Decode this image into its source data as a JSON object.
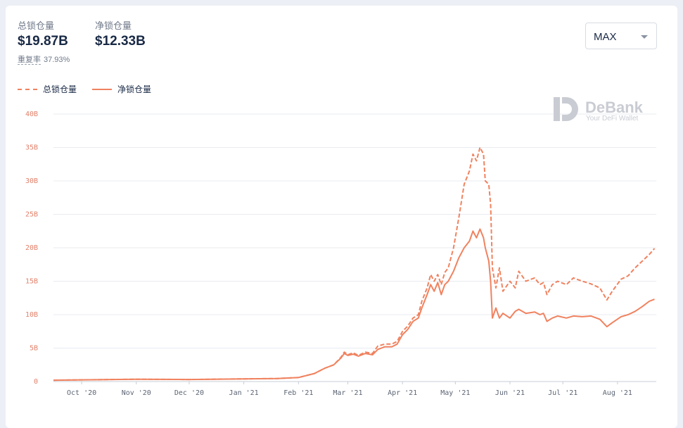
{
  "stats": {
    "total_label": "总锁仓量",
    "total_value": "$19.87B",
    "net_label": "净锁仓量",
    "net_value": "$12.33B",
    "overlap_label": "重复率",
    "overlap_value": "37.93%"
  },
  "range_select": {
    "value": "MAX"
  },
  "watermark": {
    "brand": "DeBank",
    "tagline": "Your DeFi Wallet"
  },
  "colors": {
    "line": "#f0825f",
    "tick": "#e2806a",
    "grid": "#e8ebf1",
    "axis": "#c7ccd6",
    "xtick": "#5b6474"
  },
  "chart_data": {
    "type": "line",
    "x_unit": "days",
    "x_range": [
      "2020-09-15",
      "2021-08-23"
    ],
    "ylim": [
      0,
      40
    ],
    "yticks": [
      0,
      5,
      10,
      15,
      20,
      25,
      30,
      35,
      40
    ],
    "ytick_labels": [
      "0",
      "5B",
      "10B",
      "15B",
      "20B",
      "25B",
      "30B",
      "35B",
      "40B"
    ],
    "xticks": [
      {
        "date": "2020-10-01",
        "label": "Oct '20"
      },
      {
        "date": "2020-11-01",
        "label": "Nov '20"
      },
      {
        "date": "2020-12-01",
        "label": "Dec '20"
      },
      {
        "date": "2021-01-01",
        "label": "Jan '21"
      },
      {
        "date": "2021-02-01",
        "label": "Feb '21"
      },
      {
        "date": "2021-03-01",
        "label": "Mar '21"
      },
      {
        "date": "2021-04-01",
        "label": "Apr '21"
      },
      {
        "date": "2021-05-01",
        "label": "May '21"
      },
      {
        "date": "2021-06-01",
        "label": "Jun '21"
      },
      {
        "date": "2021-07-01",
        "label": "Jul '21"
      },
      {
        "date": "2021-08-01",
        "label": "Aug '21"
      }
    ],
    "legend_position": "top-left",
    "grid": true,
    "series": [
      {
        "name": "总锁仓量",
        "style": "dashed",
        "points": [
          [
            "2020-09-15",
            0.2
          ],
          [
            "2020-10-01",
            0.25
          ],
          [
            "2020-11-01",
            0.35
          ],
          [
            "2020-12-01",
            0.3
          ],
          [
            "2021-01-01",
            0.4
          ],
          [
            "2021-01-20",
            0.45
          ],
          [
            "2021-02-01",
            0.6
          ],
          [
            "2021-02-10",
            1.2
          ],
          [
            "2021-02-16",
            2.0
          ],
          [
            "2021-02-21",
            2.5
          ],
          [
            "2021-02-25",
            3.6
          ],
          [
            "2021-02-27",
            4.4
          ],
          [
            "2021-03-01",
            4.0
          ],
          [
            "2021-03-04",
            4.3
          ],
          [
            "2021-03-07",
            3.9
          ],
          [
            "2021-03-11",
            4.4
          ],
          [
            "2021-03-15",
            4.2
          ],
          [
            "2021-03-18",
            5.3
          ],
          [
            "2021-03-22",
            5.6
          ],
          [
            "2021-03-26",
            5.6
          ],
          [
            "2021-03-29",
            6.0
          ],
          [
            "2021-04-01",
            7.5
          ],
          [
            "2021-04-04",
            8.3
          ],
          [
            "2021-04-07",
            9.5
          ],
          [
            "2021-04-10",
            10.0
          ],
          [
            "2021-04-12",
            12.0
          ],
          [
            "2021-04-15",
            14.0
          ],
          [
            "2021-04-17",
            16.0
          ],
          [
            "2021-04-19",
            15.0
          ],
          [
            "2021-04-21",
            16.0
          ],
          [
            "2021-04-23",
            14.5
          ],
          [
            "2021-04-25",
            16.3
          ],
          [
            "2021-04-27",
            17.0
          ],
          [
            "2021-04-30",
            20.0
          ],
          [
            "2021-05-03",
            24.5
          ],
          [
            "2021-05-06",
            29.5
          ],
          [
            "2021-05-09",
            31.5
          ],
          [
            "2021-05-11",
            34.0
          ],
          [
            "2021-05-13",
            33.0
          ],
          [
            "2021-05-15",
            35.0
          ],
          [
            "2021-05-17",
            34.0
          ],
          [
            "2021-05-18",
            30.0
          ],
          [
            "2021-05-20",
            29.5
          ],
          [
            "2021-05-21",
            26.5
          ],
          [
            "2021-05-22",
            17.0
          ],
          [
            "2021-05-24",
            14.0
          ],
          [
            "2021-05-26",
            17.0
          ],
          [
            "2021-05-28",
            13.5
          ],
          [
            "2021-06-01",
            15.0
          ],
          [
            "2021-06-04",
            14.0
          ],
          [
            "2021-06-06",
            16.5
          ],
          [
            "2021-06-10",
            15.0
          ],
          [
            "2021-06-15",
            15.5
          ],
          [
            "2021-06-18",
            14.5
          ],
          [
            "2021-06-20",
            14.8
          ],
          [
            "2021-06-22",
            13.0
          ],
          [
            "2021-06-25",
            14.5
          ],
          [
            "2021-06-28",
            15.0
          ],
          [
            "2021-07-03",
            14.5
          ],
          [
            "2021-07-07",
            15.5
          ],
          [
            "2021-07-12",
            15.0
          ],
          [
            "2021-07-17",
            14.6
          ],
          [
            "2021-07-22",
            14.0
          ],
          [
            "2021-07-26",
            12.2
          ],
          [
            "2021-07-29",
            13.5
          ],
          [
            "2021-08-03",
            15.3
          ],
          [
            "2021-08-07",
            15.8
          ],
          [
            "2021-08-11",
            17.0
          ],
          [
            "2021-08-15",
            18.0
          ],
          [
            "2021-08-19",
            19.0
          ],
          [
            "2021-08-22",
            19.9
          ]
        ]
      },
      {
        "name": "净锁仓量",
        "style": "solid",
        "points": [
          [
            "2020-09-15",
            0.2
          ],
          [
            "2020-10-01",
            0.25
          ],
          [
            "2020-11-01",
            0.35
          ],
          [
            "2020-12-01",
            0.3
          ],
          [
            "2021-01-01",
            0.4
          ],
          [
            "2021-01-20",
            0.45
          ],
          [
            "2021-02-01",
            0.6
          ],
          [
            "2021-02-10",
            1.2
          ],
          [
            "2021-02-16",
            2.0
          ],
          [
            "2021-02-21",
            2.5
          ],
          [
            "2021-02-25",
            3.5
          ],
          [
            "2021-02-27",
            4.2
          ],
          [
            "2021-03-01",
            3.9
          ],
          [
            "2021-03-04",
            4.1
          ],
          [
            "2021-03-07",
            3.8
          ],
          [
            "2021-03-11",
            4.2
          ],
          [
            "2021-03-15",
            4.0
          ],
          [
            "2021-03-18",
            4.8
          ],
          [
            "2021-03-22",
            5.2
          ],
          [
            "2021-03-26",
            5.2
          ],
          [
            "2021-03-29",
            5.6
          ],
          [
            "2021-04-01",
            7.0
          ],
          [
            "2021-04-04",
            7.8
          ],
          [
            "2021-04-07",
            9.0
          ],
          [
            "2021-04-10",
            9.5
          ],
          [
            "2021-04-12",
            11.0
          ],
          [
            "2021-04-15",
            13.0
          ],
          [
            "2021-04-17",
            14.5
          ],
          [
            "2021-04-19",
            13.5
          ],
          [
            "2021-04-21",
            14.8
          ],
          [
            "2021-04-23",
            13.0
          ],
          [
            "2021-04-25",
            14.5
          ],
          [
            "2021-04-27",
            15.0
          ],
          [
            "2021-04-30",
            16.5
          ],
          [
            "2021-05-03",
            18.5
          ],
          [
            "2021-05-06",
            20.0
          ],
          [
            "2021-05-09",
            21.0
          ],
          [
            "2021-05-11",
            22.5
          ],
          [
            "2021-05-13",
            21.5
          ],
          [
            "2021-05-15",
            22.8
          ],
          [
            "2021-05-17",
            21.5
          ],
          [
            "2021-05-18",
            20.0
          ],
          [
            "2021-05-20",
            18.0
          ],
          [
            "2021-05-21",
            15.0
          ],
          [
            "2021-05-22",
            9.5
          ],
          [
            "2021-05-24",
            11.0
          ],
          [
            "2021-05-26",
            9.5
          ],
          [
            "2021-05-28",
            10.2
          ],
          [
            "2021-06-01",
            9.5
          ],
          [
            "2021-06-04",
            10.5
          ],
          [
            "2021-06-06",
            10.8
          ],
          [
            "2021-06-10",
            10.2
          ],
          [
            "2021-06-15",
            10.4
          ],
          [
            "2021-06-18",
            10.0
          ],
          [
            "2021-06-20",
            10.2
          ],
          [
            "2021-06-22",
            9.0
          ],
          [
            "2021-06-25",
            9.5
          ],
          [
            "2021-06-28",
            9.8
          ],
          [
            "2021-07-03",
            9.5
          ],
          [
            "2021-07-07",
            9.8
          ],
          [
            "2021-07-12",
            9.7
          ],
          [
            "2021-07-17",
            9.8
          ],
          [
            "2021-07-22",
            9.3
          ],
          [
            "2021-07-26",
            8.2
          ],
          [
            "2021-07-29",
            8.8
          ],
          [
            "2021-08-03",
            9.7
          ],
          [
            "2021-08-07",
            10.0
          ],
          [
            "2021-08-11",
            10.5
          ],
          [
            "2021-08-15",
            11.2
          ],
          [
            "2021-08-19",
            12.0
          ],
          [
            "2021-08-22",
            12.3
          ]
        ]
      }
    ]
  }
}
